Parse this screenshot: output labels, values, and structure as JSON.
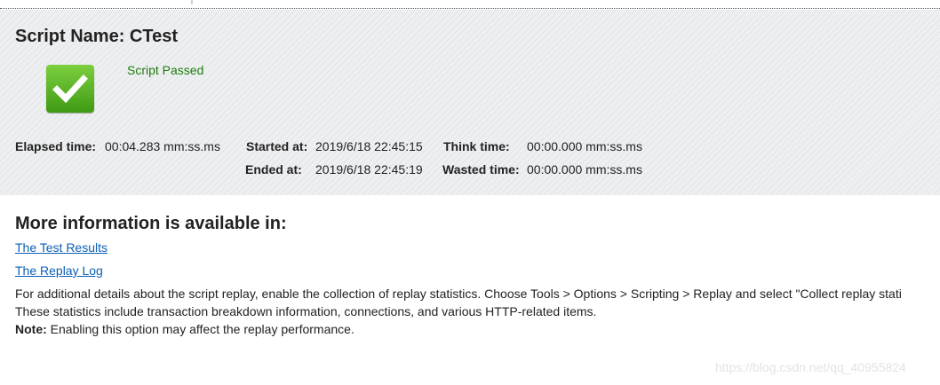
{
  "script": {
    "title": "Script Name: CTest",
    "status": "Script Passed",
    "status_icon": "check-icon",
    "status_color": "#1e7d10"
  },
  "stats": {
    "elapsed_label": "Elapsed time:",
    "elapsed_value": "00:04.283 mm:ss.ms",
    "started_label": "Started at:",
    "started_value": "2019/6/18 22:45:15",
    "ended_label": "Ended at:",
    "ended_value": "2019/6/18 22:45:19",
    "think_label": "Think time:",
    "think_value": "00:00.000 mm:ss.ms",
    "wasted_label": "Wasted time:",
    "wasted_value": "00:00.000 mm:ss.ms"
  },
  "more": {
    "heading": "More information is available in:",
    "links": [
      "The Test Results",
      "The Replay Log"
    ],
    "line1": "For additional details about the script replay, enable the collection of replay statistics. Choose Tools > Options > Scripting > Replay and select \"Collect replay stati",
    "line2": "These statistics include transaction breakdown information, connections, and various HTTP-related items.",
    "note_label": "Note:",
    "note_text": " Enabling this option may affect the replay performance."
  },
  "watermark": "https://blog.csdn.net/qq_40955824",
  "colors": {
    "link": "#0b5fb4",
    "panel_bg": "#eeeff1",
    "icon_green": "#3f9b14"
  }
}
